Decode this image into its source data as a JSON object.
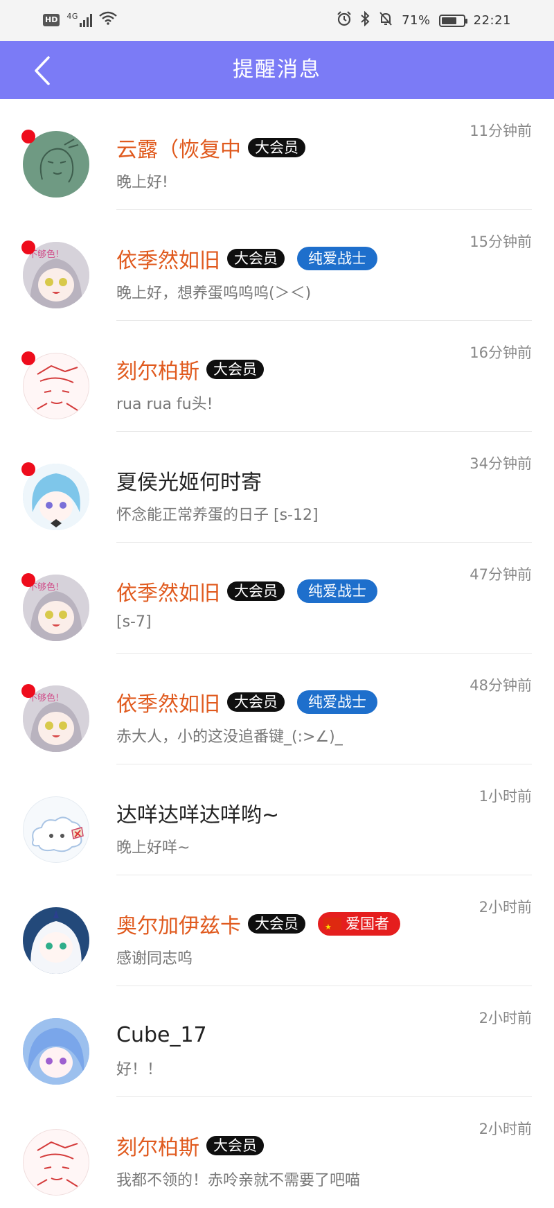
{
  "status_bar": {
    "hd": "HD",
    "network": "4G",
    "battery_text": "71%",
    "battery_level": 0.71,
    "time": "22:21"
  },
  "header": {
    "title": "提醒消息"
  },
  "colors": {
    "header_bg": "#7b7bf6",
    "vip_name": "#e05a1e",
    "unread_dot": "#ee0c1c",
    "badge_blue": "#1e6fcc",
    "badge_red": "#e51e1e"
  },
  "messages": [
    {
      "name": "云露（恢复中",
      "vip": "大会员",
      "tag": "",
      "text": "晚上好!",
      "time": "11分钟前",
      "unread": true
    },
    {
      "name": "依季然如旧",
      "vip": "大会员",
      "tag": "纯爱战士",
      "text": "晚上好，想养蛋呜呜呜(＞＜)",
      "time": "15分钟前",
      "unread": true
    },
    {
      "name": "刻尔柏斯",
      "vip": "大会员",
      "tag": "",
      "text": "rua rua fu头!",
      "time": "16分钟前",
      "unread": true
    },
    {
      "name": "夏侯光姬何时寄",
      "vip": "",
      "tag": "",
      "text": "怀念能正常养蛋的日子 [s-12]",
      "time": "34分钟前",
      "unread": true
    },
    {
      "name": "依季然如旧",
      "vip": "大会员",
      "tag": "纯爱战士",
      "text": "[s-7]",
      "time": "47分钟前",
      "unread": true
    },
    {
      "name": "依季然如旧",
      "vip": "大会员",
      "tag": "纯爱战士",
      "text": "赤大人，小的这没追番键_(:>∠)_",
      "time": "48分钟前",
      "unread": true
    },
    {
      "name": "达咩达咩达咩哟~",
      "vip": "",
      "tag": "",
      "text": "晚上好咩~",
      "time": "1小时前",
      "unread": false
    },
    {
      "name": "奥尔加伊兹卡",
      "vip": "大会员",
      "tag": "爱国者",
      "text": "感谢同志呜",
      "time": "2小时前",
      "unread": false
    },
    {
      "name": "Cube_17",
      "vip": "",
      "tag": "",
      "text": "好！！",
      "time": "2小时前",
      "unread": false
    },
    {
      "name": "刻尔柏斯",
      "vip": "大会员",
      "tag": "",
      "text": "我都不领的！赤呤亲就不需要了吧喵",
      "time": "2小时前",
      "unread": false
    }
  ],
  "icons": {
    "back": "chevron-left-icon",
    "wifi": "wifi-icon",
    "signal": "signal-icon",
    "alarm": "alarm-icon",
    "bluetooth": "bluetooth-icon",
    "mute": "bell-off-icon",
    "battery": "battery-icon"
  }
}
